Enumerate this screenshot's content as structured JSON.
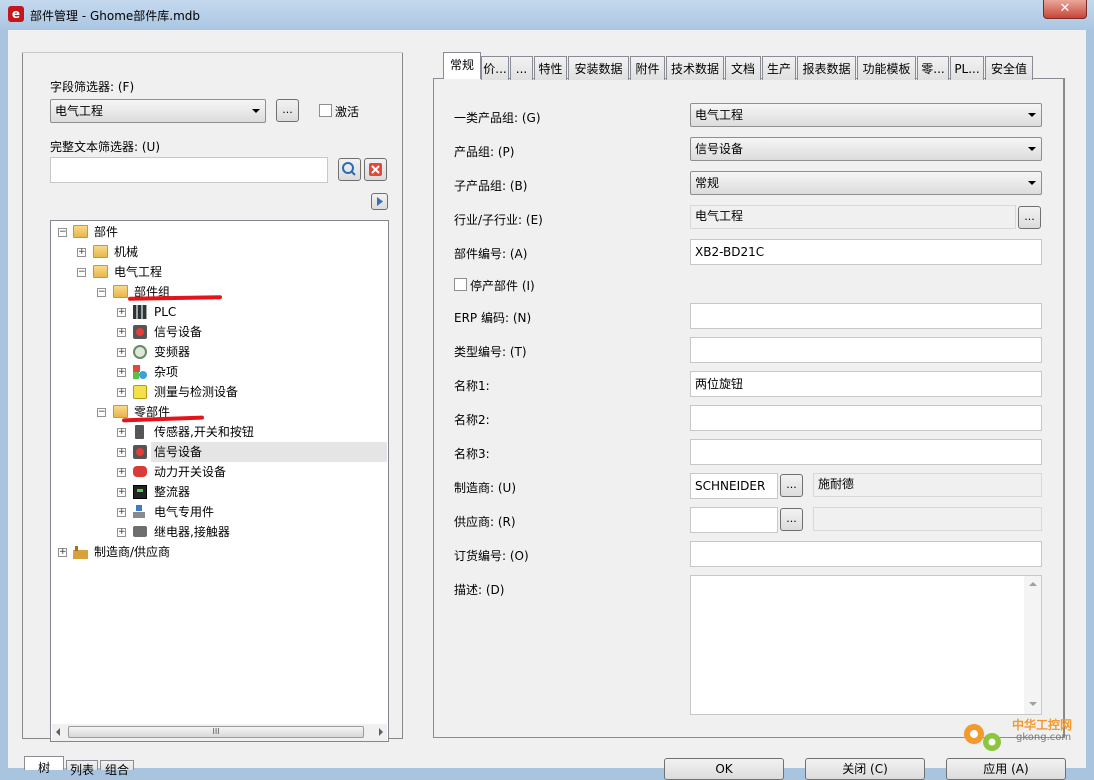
{
  "window": {
    "title": "部件管理 - Ghome部件库.mdb",
    "app_icon": "e",
    "close_label": "✕"
  },
  "filter": {
    "field_label": "字段筛选器: (F)",
    "field_value": "电气工程",
    "browse_label": "...",
    "activate_label": "激活",
    "fulltext_label": "完整文本筛选器: (U)",
    "fulltext_value": ""
  },
  "tree": {
    "root": "部件",
    "mechanical": "机械",
    "electrical": "电气工程",
    "parts_group": "部件组",
    "plc": "PLC",
    "signal_device": "信号设备",
    "vfd": "变频器",
    "misc": "杂项",
    "measure": "测量与检测设备",
    "components": "零部件",
    "sensors": "传感器,开关和按钮",
    "signal_device2": "信号设备",
    "power_switch": "动力开关设备",
    "rectifier": "整流器",
    "special_parts": "电气专用件",
    "relay": "继电器,接触器",
    "manufacturer": "制造商/供应商",
    "scroll_grip": "III"
  },
  "bottom_tabs": [
    "树",
    "列表",
    "组合"
  ],
  "tabs": [
    "常规",
    "价...",
    "...",
    "特性",
    "安装数据",
    "附件",
    "技术数据",
    "文档",
    "生产",
    "报表数据",
    "功能模板",
    "零...",
    "PL...",
    "安全值"
  ],
  "form": {
    "product_group1_label": "一类产品组: (G)",
    "product_group1_value": "电气工程",
    "product_group_label": "产品组: (P)",
    "product_group_value": "信号设备",
    "sub_product_group_label": "子产品组: (B)",
    "sub_product_group_value": "常规",
    "industry_label": "行业/子行业: (E)",
    "industry_value": "电气工程",
    "part_number_label": "部件编号: (A)",
    "part_number_value": "XB2-BD21C",
    "discontinued_label": "停产部件 (I)",
    "erp_label": "ERP 编码: (N)",
    "erp_value": "",
    "type_number_label": "类型编号: (T)",
    "type_number_value": "",
    "name1_label": "名称1:",
    "name1_value": "两位旋钮",
    "name2_label": "名称2:",
    "name2_value": "",
    "name3_label": "名称3:",
    "name3_value": "",
    "manufacturer_label": "制造商: (U)",
    "manufacturer_value": "SCHNEIDER",
    "manufacturer_name": "施耐德",
    "supplier_label": "供应商: (R)",
    "supplier_value": "",
    "supplier_name": "",
    "order_number_label": "订货编号: (O)",
    "order_number_value": "",
    "description_label": "描述: (D)",
    "description_value": ""
  },
  "bottom_buttons": [
    "OK",
    "关闭 (C)",
    "应用 (A)"
  ],
  "watermark": {
    "text": "中华工控网",
    "url": "gkong.com"
  },
  "colors": {
    "annotation_red": "#e5141b",
    "selected_row": "#e5e5e5"
  }
}
